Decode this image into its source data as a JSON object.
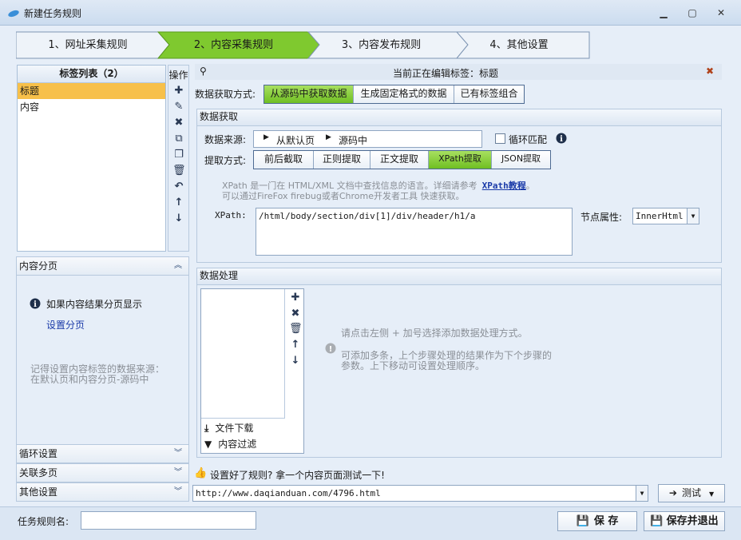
{
  "window": {
    "title": "新建任务规则"
  },
  "steps": [
    {
      "label": "1、网址采集规则"
    },
    {
      "label": "2、内容采集规则"
    },
    {
      "label": "3、内容发布规则"
    },
    {
      "label": "4、其他设置"
    }
  ],
  "tags": {
    "header": "标签列表（2）",
    "items": [
      "标题",
      "内容"
    ],
    "ops_label": "操作"
  },
  "editing": {
    "label": "当前正在编辑标签：标题"
  },
  "data_mode": {
    "label": "数据获取方式:",
    "options": [
      "从源码中获取数据",
      "生成固定格式的数据",
      "已有标签组合"
    ]
  },
  "acquire": {
    "section_title": "数据获取",
    "source_label": "数据来源:",
    "source_a": "从默认页",
    "source_b": "源码中",
    "loop_label": "循环匹配",
    "extract_label": "提取方式:",
    "extract_options": [
      "前后截取",
      "正则提取",
      "正文提取",
      "XPath提取",
      "JSON提取"
    ],
    "hint1": "XPath 是一门在 HTML/XML 文档中查找信息的语言。详细请参考",
    "hint1_link": "XPath教程",
    "hint1_end": "。",
    "hint2": "可以通过FireFox firebug或者Chrome开发者工具 快速获取。",
    "xpath_label": "XPath:",
    "xpath_value": "/html/body/section/div[1]/div/header/h1/a",
    "node_label": "节点属性:",
    "node_value": "InnerHtml"
  },
  "processing": {
    "section_title": "数据处理",
    "items": [
      "文件下载",
      "内容过滤"
    ],
    "hint1": "请点击左侧 + 加号选择添加数据处理方式。",
    "hint2": "可添加多条，上个步骤处理的结果作为下个步骤的",
    "hint3": "参数。上下移动可设置处理顺序。"
  },
  "pagination": {
    "title": "内容分页",
    "info": "如果内容结果分页显示",
    "link": "设置分页",
    "note1": "记得设置内容标签的数据来源：",
    "note2": "在默认页和内容分页-源码中"
  },
  "accordion": [
    "循环设置",
    "关联多页",
    "其他设置"
  ],
  "test": {
    "prompt": "设置好了规则? 拿一个内容页面测试一下!",
    "url": "http://www.daqianduan.com/4796.html",
    "button": "测试"
  },
  "footer": {
    "name_label": "任务规则名:",
    "name_value": "",
    "save": "保 存",
    "save_exit": "保存并退出"
  },
  "colors": {
    "accent": "#7cc42a",
    "selected": "#f7c04a"
  }
}
